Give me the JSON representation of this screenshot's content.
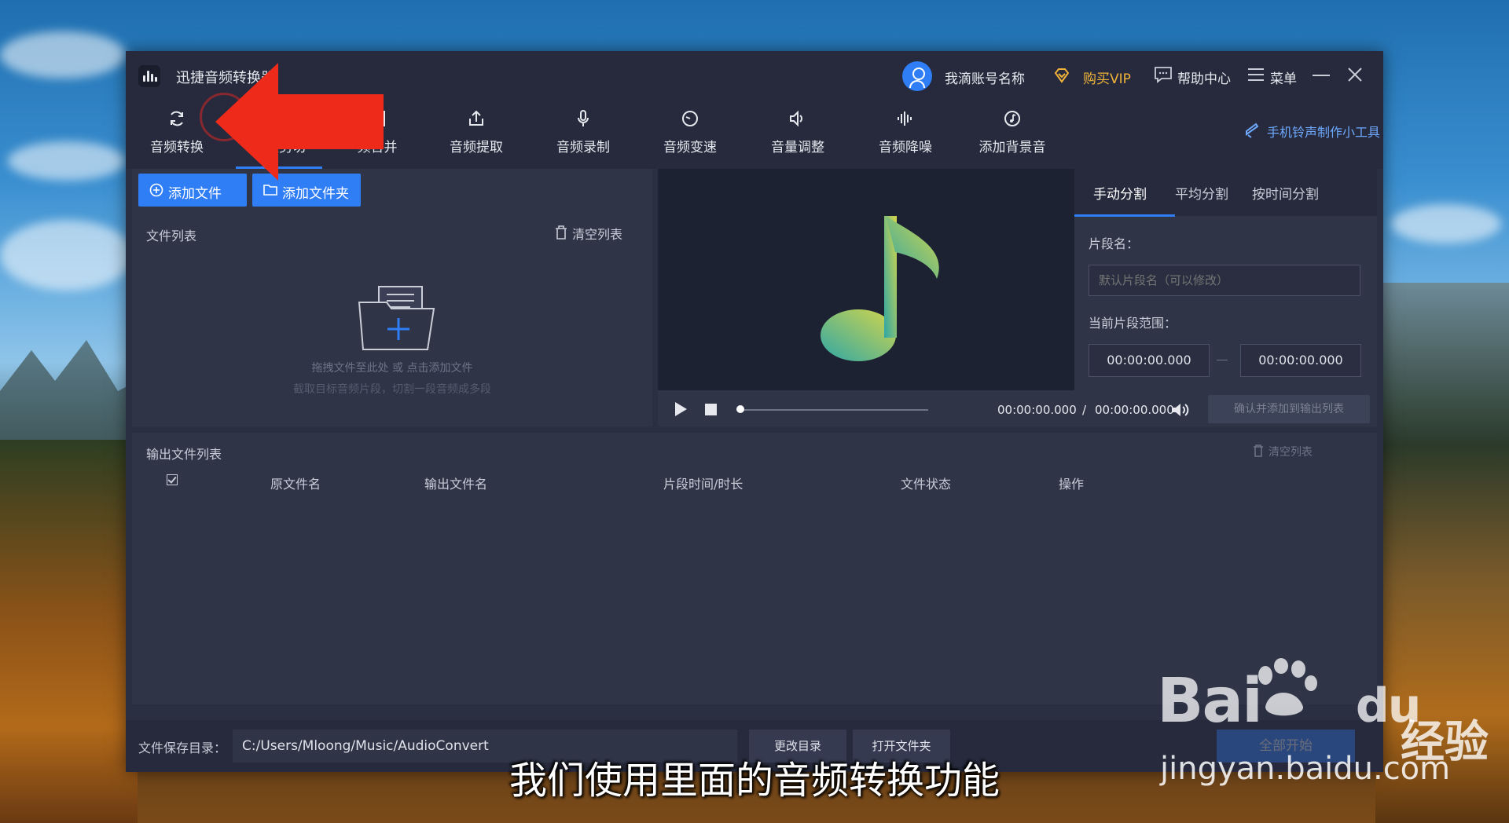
{
  "app": {
    "title": "迅捷音频转换器",
    "user_name": "我滴账号名称",
    "buy_vip": "购买VIP",
    "help_center": "帮助中心",
    "menu": "菜单"
  },
  "toolbar": {
    "items": [
      {
        "label": "音频转换",
        "icon": "convert-icon"
      },
      {
        "label": "音频剪切",
        "icon": "scissors-icon"
      },
      {
        "label": "频合并",
        "icon": "merge-icon"
      },
      {
        "label": "音频提取",
        "icon": "extract-icon"
      },
      {
        "label": "音频录制",
        "icon": "microphone-icon"
      },
      {
        "label": "音频变速",
        "icon": "speed-icon"
      },
      {
        "label": "音量调整",
        "icon": "volume-adjust-icon"
      },
      {
        "label": "音频降噪",
        "icon": "denoise-icon"
      },
      {
        "label": "添加背景音",
        "icon": "bg-music-icon"
      }
    ],
    "ringtone_tool": "手机铃声制作小工具"
  },
  "file_panel": {
    "add_file": "添加文件",
    "add_folder": "添加文件夹",
    "list_label": "文件列表",
    "clear_list": "清空列表",
    "drop_hint": "拖拽文件至此处 或 点击添加文件",
    "drop_hint_sub": "截取目标音频片段，切割一段音频成多段"
  },
  "split_panel": {
    "tabs": [
      "手动分割",
      "平均分割",
      "按时间分割"
    ],
    "segment_name_label": "片段名：",
    "segment_name_placeholder": "默认片段名（可以修改）",
    "segment_range_label": "当前片段范围：",
    "range_start": "00:00:00.000",
    "range_end": "00:00:00.000",
    "current_time": "00:00:00.000",
    "time_separator": "/",
    "total_time": "00:00:00.000",
    "confirm_button": "确认并添加到输出列表"
  },
  "output_panel": {
    "label": "输出文件列表",
    "clear_list": "清空列表",
    "columns": [
      "原文件名",
      "输出文件名",
      "片段时间/时长",
      "文件状态",
      "操作"
    ]
  },
  "statusbar": {
    "save_dir_label": "文件保存目录：",
    "save_dir_value": "C:/Users/Mloong/Music/AudioConvert",
    "change_dir": "更改目录",
    "open_folder": "打开文件夹",
    "start_button": "全部开始"
  },
  "overlay": {
    "subtitle": "我们使用里面的音频转换功能",
    "watermark_brand": "Bai",
    "watermark_du": "du",
    "watermark_sub": "经验",
    "watermark_url": "jingyan.baidu.com"
  },
  "colors": {
    "accent": "#2f7ef5",
    "vip": "#f0b33a",
    "arrow": "#ee2a1b"
  }
}
